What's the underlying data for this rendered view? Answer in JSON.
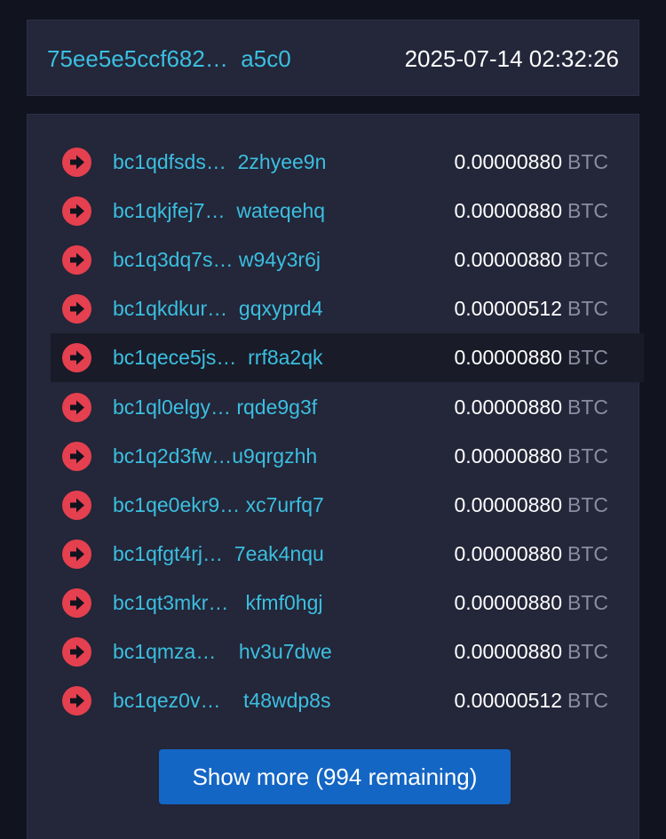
{
  "transaction": {
    "hash": "75ee5e5ccf682…  a5c0",
    "timestamp": "2025-07-14 02:32:26"
  },
  "outputs": [
    {
      "address": "bc1qdfsds…  2zhyee9n",
      "amount": "0.00000880",
      "unit": "BTC"
    },
    {
      "address": "bc1qkjfej7…  wateqehq",
      "amount": "0.00000880",
      "unit": "BTC"
    },
    {
      "address": "bc1q3dq7s… w94y3r6j",
      "amount": "0.00000880",
      "unit": "BTC"
    },
    {
      "address": "bc1qkdkur…  gqxyprd4",
      "amount": "0.00000512",
      "unit": "BTC"
    },
    {
      "address": "bc1qece5js…  rrf8a2qk",
      "amount": "0.00000880",
      "unit": "BTC"
    },
    {
      "address": "bc1ql0elgy… rqde9g3f",
      "amount": "0.00000880",
      "unit": "BTC"
    },
    {
      "address": "bc1q2d3fw…u9qrgzhh",
      "amount": "0.00000880",
      "unit": "BTC"
    },
    {
      "address": "bc1qe0ekr9… xc7urfq7",
      "amount": "0.00000880",
      "unit": "BTC"
    },
    {
      "address": "bc1qfgt4rj…  7eak4nqu",
      "amount": "0.00000880",
      "unit": "BTC"
    },
    {
      "address": "bc1qt3mkr…   kfmf0hgj",
      "amount": "0.00000880",
      "unit": "BTC"
    },
    {
      "address": "bc1qmza…    hv3u7dwe",
      "amount": "0.00000880",
      "unit": "BTC"
    },
    {
      "address": "bc1qez0v…    t48wdp8s",
      "amount": "0.00000512",
      "unit": "BTC"
    }
  ],
  "show_more_label": "Show more (994 remaining)",
  "icons": {
    "output_arrow": "arrow-right-circle-icon"
  },
  "colors": {
    "background": "#11131f",
    "panel": "#242639",
    "link": "#3bbfe0",
    "arrow": "#e5404f",
    "button": "#1466c4",
    "unit_text": "#8a8da0"
  }
}
